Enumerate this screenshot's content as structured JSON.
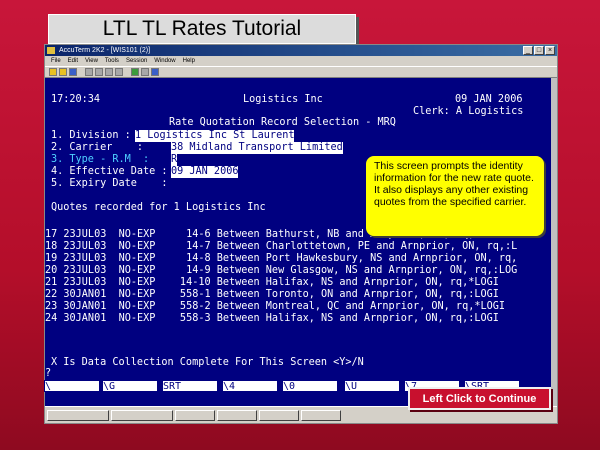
{
  "slide": {
    "title": "LTL TL Rates Tutorial",
    "callout": "This screen prompts the identity information for the new rate quote. It also displays any other existing quotes from the specified carrier.",
    "continue_button": "Left Click to Continue"
  },
  "window": {
    "title": "AccuTerm 2K2 - [WIS101 (2)]",
    "menu": [
      "File",
      "Edit",
      "View",
      "Tools",
      "Session",
      "Window",
      "Help"
    ]
  },
  "terminal": {
    "time": "17:20:34",
    "company": "Logistics Inc",
    "date": "09 JAN 2006",
    "clerk": "Clerk: A Logistics",
    "screen_title": "Rate Quotation Record Selection - MRQ",
    "fields": [
      {
        "label": "1. Division :",
        "value": "1 Logistics Inc St Laurent"
      },
      {
        "label": "2. Carrier    :",
        "value": "38 Midland Transport Limited"
      },
      {
        "label": "3. Type - R.M  :",
        "value": "R"
      },
      {
        "label": "4. Effective Date :",
        "value": "09 JAN 2006"
      },
      {
        "label": "5. Expiry Date    :",
        "value": ""
      }
    ],
    "quotes_header": "Quotes recorded for 1 Logistics Inc",
    "quote_rows": [
      "17 23JUL03  NO-EXP     14-6 Between Bathurst, NB and Arnprior, ON, rq,:LOGI",
      "18 23JUL03  NO-EXP     14-7 Between Charlottetown, PE and Arnprior, ON, rq,:L",
      "19 23JUL03  NO-EXP     14-8 Between Port Hawkesbury, NS and Arnprior, ON, rq,",
      "20 23JUL03  NO-EXP     14-9 Between New Glasgow, NS and Arnprior, ON, rq,:LOG",
      "21 23JUL03  NO-EXP    14-10 Between Halifax, NS and Arnprior, ON, rq,*LOGI",
      "22 30JAN01  NO-EXP    558-1 Between Toronto, ON and Arnprior, ON, rq,:LOGI",
      "23 30JAN01  NO-EXP    558-2 Between Montreal, QC and Arnprior, ON, rq,*LOGI",
      "24 30JAN01  NO-EXP    558-3 Between Halifax, NS and Arnprior, ON, rq,:LOGI"
    ],
    "prompt": "X Is Data Collection Complete For This Screen <Y>/N",
    "cursor": "?",
    "fkeys": [
      "\\",
      "\\G",
      "SRT",
      "\\4",
      "\\0",
      "\\U",
      "\\7",
      "\\SRT"
    ]
  }
}
